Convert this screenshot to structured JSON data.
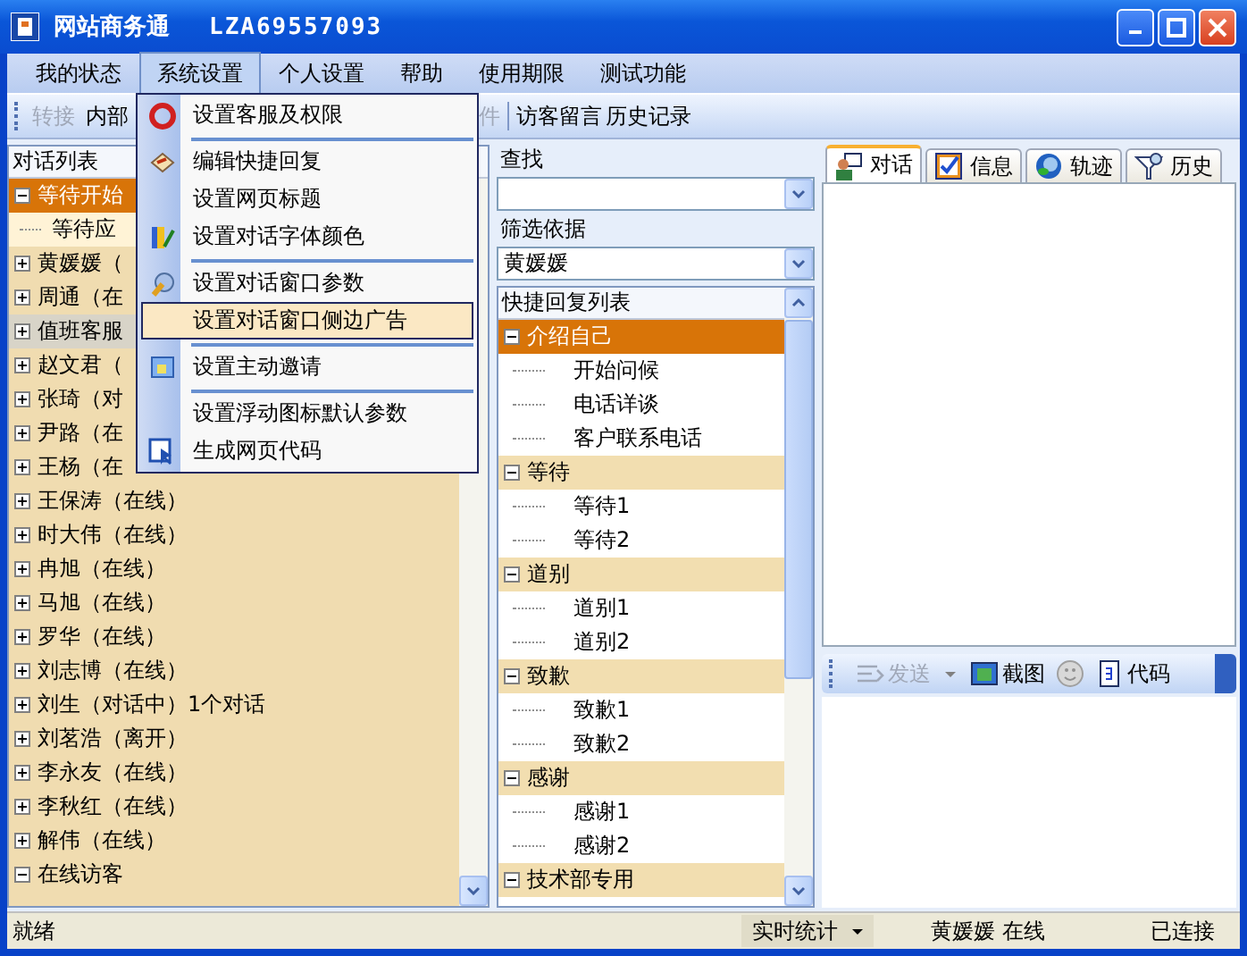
{
  "title_bar": {
    "app_name": "网站商务通",
    "serial": "LZA69557093"
  },
  "menu_bar": [
    {
      "label": "我的状态",
      "selected": false
    },
    {
      "label": "系统设置",
      "selected": true
    },
    {
      "label": "个人设置",
      "selected": false
    },
    {
      "label": "帮助",
      "selected": false
    },
    {
      "label": "使用期限",
      "selected": false
    },
    {
      "label": "测试功能",
      "selected": false
    }
  ],
  "dropdown_menu": [
    {
      "kind": "item",
      "label": "设置客服及权限",
      "highlighted": false
    },
    {
      "kind": "separator"
    },
    {
      "kind": "item",
      "label": "编辑快捷回复",
      "highlighted": false
    },
    {
      "kind": "item",
      "label": "设置网页标题",
      "highlighted": false
    },
    {
      "kind": "item",
      "label": "设置对话字体颜色",
      "highlighted": false
    },
    {
      "kind": "separator"
    },
    {
      "kind": "item",
      "label": "设置对话窗口参数",
      "highlighted": false
    },
    {
      "kind": "item",
      "label": "设置对话窗口侧边广告",
      "highlighted": true
    },
    {
      "kind": "separator"
    },
    {
      "kind": "item",
      "label": "设置主动邀请",
      "highlighted": false
    },
    {
      "kind": "separator"
    },
    {
      "kind": "item",
      "label": "设置浮动图标默认参数",
      "highlighted": false
    },
    {
      "kind": "item",
      "label": "生成网页代码",
      "highlighted": false
    }
  ],
  "toolbar": [
    {
      "kind": "button",
      "label": "转接",
      "disabled": true
    },
    {
      "kind": "button",
      "label": "内部",
      "disabled": false
    },
    {
      "kind": "button",
      "label": "件",
      "disabled": true
    },
    {
      "kind": "separator"
    },
    {
      "kind": "button",
      "label": "访客留言",
      "disabled": false
    },
    {
      "kind": "button",
      "label": "历史记录",
      "disabled": false
    }
  ],
  "conversation_panel": {
    "title": "对话列表",
    "tree": [
      {
        "label": "等待开始",
        "expanded": true,
        "selected": true,
        "highlighted": false,
        "children": [
          {
            "label": "等待应"
          }
        ]
      },
      {
        "label": "黄媛媛（",
        "expanded": false,
        "selected": false,
        "highlighted": false
      },
      {
        "label": "周通（在",
        "expanded": false,
        "selected": false,
        "highlighted": false
      },
      {
        "label": "值班客服",
        "expanded": false,
        "selected": false,
        "highlighted": true
      },
      {
        "label": "赵文君（",
        "expanded": false,
        "selected": false,
        "highlighted": false
      },
      {
        "label": "张琦（对",
        "expanded": false,
        "selected": false,
        "highlighted": false
      },
      {
        "label": "尹路（在",
        "expanded": false,
        "selected": false,
        "highlighted": false
      },
      {
        "label": "王杨（在",
        "expanded": false,
        "selected": false,
        "highlighted": false
      },
      {
        "label": "王保涛（在线）",
        "expanded": false,
        "selected": false,
        "highlighted": false
      },
      {
        "label": "时大伟（在线）",
        "expanded": false,
        "selected": false,
        "highlighted": false
      },
      {
        "label": "冉旭（在线）",
        "expanded": false,
        "selected": false,
        "highlighted": false
      },
      {
        "label": "马旭（在线）",
        "expanded": false,
        "selected": false,
        "highlighted": false
      },
      {
        "label": "罗华（在线）",
        "expanded": false,
        "selected": false,
        "highlighted": false
      },
      {
        "label": "刘志博（在线）",
        "expanded": false,
        "selected": false,
        "highlighted": false
      },
      {
        "label": "刘生（对话中）1个对话",
        "expanded": false,
        "selected": false,
        "highlighted": false
      },
      {
        "label": "刘茗浩（离开）",
        "expanded": false,
        "selected": false,
        "highlighted": false
      },
      {
        "label": "李永友（在线）",
        "expanded": false,
        "selected": false,
        "highlighted": false
      },
      {
        "label": "李秋红（在线）",
        "expanded": false,
        "selected": false,
        "highlighted": false
      },
      {
        "label": "解伟（在线）",
        "expanded": false,
        "selected": false,
        "highlighted": false
      },
      {
        "label": "在线访客",
        "expanded": true,
        "selected": false,
        "highlighted": false
      }
    ]
  },
  "quick_reply": {
    "search_label": "查找",
    "filter_label": "筛选依据",
    "filter_value": "黄媛媛",
    "list_title": "快捷回复列表",
    "tree": [
      {
        "label": "介绍自己",
        "expanded": true,
        "selected": true,
        "children": [
          {
            "label": "开始问候"
          },
          {
            "label": "电话详谈"
          },
          {
            "label": "客户联系电话"
          }
        ]
      },
      {
        "label": "等待",
        "expanded": true,
        "selected": false,
        "children": [
          {
            "label": "等待1"
          },
          {
            "label": "等待2"
          }
        ]
      },
      {
        "label": "道别",
        "expanded": true,
        "selected": false,
        "children": [
          {
            "label": "道别1"
          },
          {
            "label": "道别2"
          }
        ]
      },
      {
        "label": "致歉",
        "expanded": true,
        "selected": false,
        "children": [
          {
            "label": "致歉1"
          },
          {
            "label": "致歉2"
          }
        ]
      },
      {
        "label": "感谢",
        "expanded": true,
        "selected": false,
        "children": [
          {
            "label": "感谢1"
          },
          {
            "label": "感谢2"
          }
        ]
      },
      {
        "label": "技术部专用",
        "expanded": true,
        "selected": false
      }
    ]
  },
  "chat_tabs": [
    {
      "label": "对话",
      "selected": true
    },
    {
      "label": "信息",
      "selected": false
    },
    {
      "label": "轨迹",
      "selected": false
    },
    {
      "label": "历史",
      "selected": false
    }
  ],
  "chat_toolbar": [
    {
      "kind": "dropdown",
      "label": "发送",
      "disabled": true
    },
    {
      "kind": "button",
      "label": "截图",
      "disabled": false
    },
    {
      "kind": "icon",
      "disabled": true
    },
    {
      "kind": "button",
      "label": "代码",
      "disabled": false
    }
  ],
  "status_bar": {
    "message": "就绪",
    "stats_button": "实时统计",
    "user_status": "黄媛媛 在线",
    "connection": "已连接"
  }
}
